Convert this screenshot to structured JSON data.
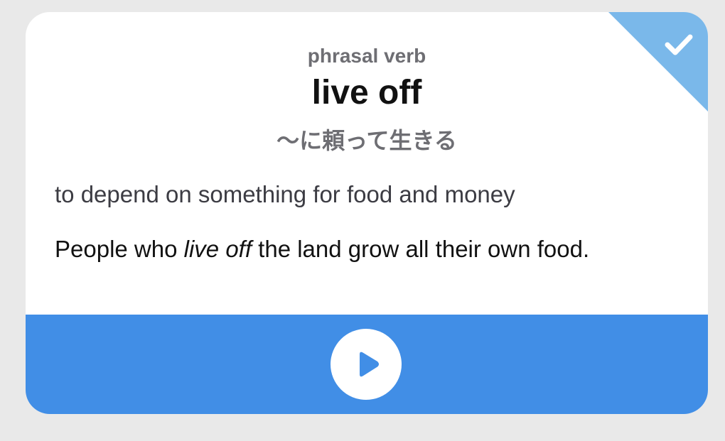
{
  "card": {
    "part_of_speech": "phrasal verb",
    "word": "live off",
    "translation": "〜に頼って生きる",
    "definition": "to depend on something for food and money",
    "example": {
      "before": "People who ",
      "highlight": "live off",
      "after": " the land grow all their own food."
    },
    "status_icon": "checkmark-icon",
    "play_icon": "play-icon"
  },
  "colors": {
    "page_background": "#e9e9e9",
    "card_background": "#ffffff",
    "corner_accent": "#7ab8ea",
    "footer_accent": "#418ee6",
    "muted_text": "#6e6e73"
  }
}
